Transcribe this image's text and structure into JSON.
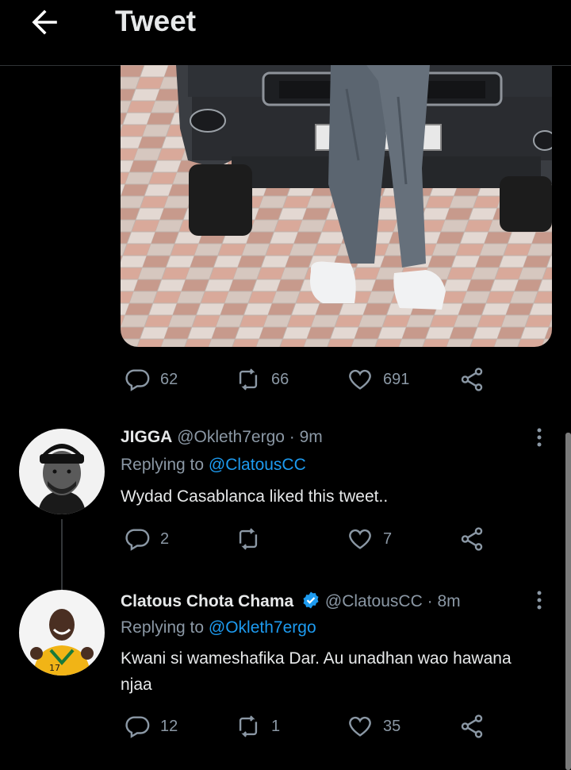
{
  "header": {
    "title": "Tweet",
    "back_icon": "arrow-left-icon"
  },
  "main_tweet": {
    "stats": {
      "replies": "62",
      "retweets": "66",
      "likes": "691"
    }
  },
  "replies": [
    {
      "name": "JIGGA",
      "handle": "@Okleth7ergo",
      "separator": "·",
      "time": "9m",
      "replying_prefix": "Replying to",
      "replying_to": "@ClatousCC",
      "text": "Wydad Casablanca liked this tweet..",
      "stats": {
        "replies": "2",
        "retweets": "",
        "likes": "7"
      }
    },
    {
      "name": "Clatous Chota Chama",
      "handle": "@ClatousCC",
      "separator": "·",
      "time": "8m",
      "verified": true,
      "replying_prefix": "Replying to",
      "replying_to": "@Okleth7ergo",
      "text": "Kwani si wameshafika Dar. Au unadhan wao hawana njaa",
      "stats": {
        "replies": "12",
        "retweets": "1",
        "likes": "35"
      }
    }
  ],
  "colors": {
    "background": "#000000",
    "text": "#e7e9ea",
    "muted": "#8b98a5",
    "link": "#1d9bf0",
    "verified": "#1d9bf0"
  }
}
